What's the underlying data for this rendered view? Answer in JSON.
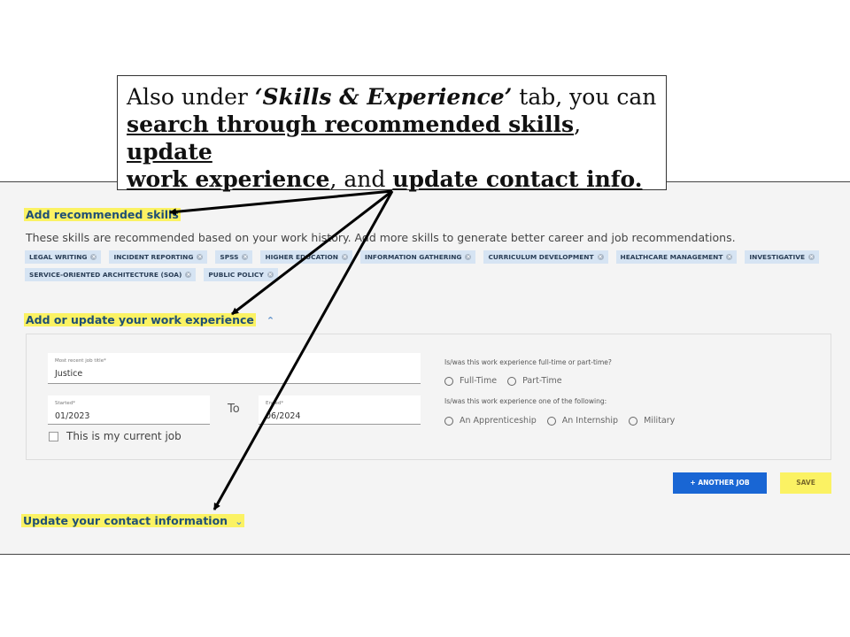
{
  "callout": {
    "l1_pre": "Also under ",
    "l1_em": "‘Skills & Experience’",
    "l1_post": " tab, you can",
    "l2_link1": "search through recommended skills",
    "l2_sep": ", ",
    "l2_link2": "update",
    "l3_link": "work experience",
    "l3_mid": ", and ",
    "l3_link2": "update contact info."
  },
  "skills": {
    "title": "Add recommended skills",
    "description": "These skills are recommended based on your work history. Add more skills to generate better career and job recommendations.",
    "chips": [
      "LEGAL WRITING",
      "INCIDENT REPORTING",
      "SPSS",
      "HIGHER EDUCATION",
      "INFORMATION GATHERING",
      "CURRICULUM DEVELOPMENT",
      "HEALTHCARE MANAGEMENT",
      "INVESTIGATIVE",
      "SERVICE-ORIENTED ARCHITECTURE (SOA)",
      "PUBLIC POLICY"
    ]
  },
  "work": {
    "title": "Add or update your work experience",
    "job_title_label": "Most recent job title*",
    "job_title_value": "Justice",
    "started_label": "Started*",
    "started_value": "01/2023",
    "to_label": "To",
    "ended_label": "Ended*",
    "ended_value": "06/2024",
    "current_job_label": "This is my current job",
    "fulltime_question": "Is/was this work experience full-time or part-time?",
    "fulltime_options": [
      "Full-Time",
      "Part-Time"
    ],
    "type_question": "Is/was this work experience one of the following:",
    "type_options": [
      "An Apprenticeship",
      "An Internship",
      "Military"
    ],
    "another_job_button": "+ ANOTHER JOB",
    "save_button": "SAVE"
  },
  "contact": {
    "title": "Update your contact information"
  },
  "colors": {
    "highlight": "#fbf263",
    "title_blue": "#1f4f75",
    "button_blue": "#1966d4",
    "chip_bg": "#d6e4f3"
  }
}
